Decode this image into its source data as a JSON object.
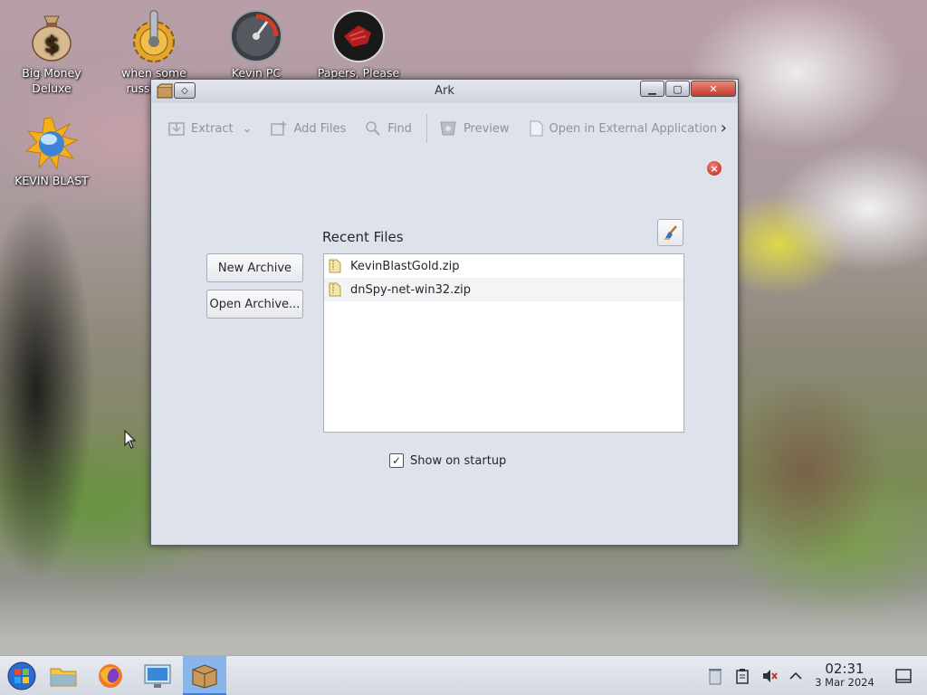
{
  "desktop": {
    "icons": [
      {
        "label": "Big Money Deluxe",
        "icon": "money-bag-icon"
      },
      {
        "label": "when some russian ...",
        "icon": "gear-joystick-icon"
      },
      {
        "label": "Kevin PC Optimizer Ho...",
        "icon": "speedometer-icon"
      },
      {
        "label": "Papers, Please",
        "icon": "papers-please-icon"
      },
      {
        "label": "KEVIN BLAST",
        "icon": "blast-globe-icon"
      }
    ]
  },
  "window": {
    "title": "Ark",
    "toolbar": {
      "extract": "Extract",
      "add_files": "Add Files",
      "find": "Find",
      "preview": "Preview",
      "open_external": "Open in External Application"
    },
    "buttons": {
      "new_archive": "New Archive",
      "open_archive": "Open Archive..."
    },
    "recent": {
      "title": "Recent Files",
      "items": [
        "KevinBlastGold.zip",
        "dnSpy-net-win32.zip"
      ]
    },
    "show_on_startup": {
      "label": "Show on startup",
      "checked": true
    }
  },
  "taskbar": {
    "clock_time": "02:31",
    "clock_date": "3 Mar 2024",
    "accent": "#88b5ea"
  }
}
